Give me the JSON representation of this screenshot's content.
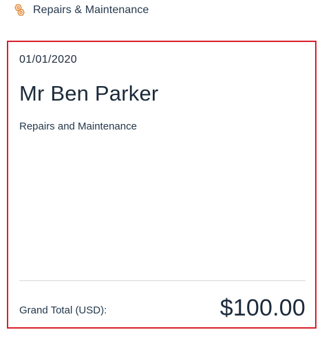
{
  "header": {
    "icon": "repairs-maintenance-icon",
    "title": "Repairs & Maintenance",
    "icon_color": "#e08a3a"
  },
  "card": {
    "date": "01/01/2020",
    "name": "Mr Ben Parker",
    "category": "Repairs and Maintenance",
    "total_label": "Grand Total (USD):",
    "total_value": "$100.00",
    "border_color": "#d8202a"
  }
}
